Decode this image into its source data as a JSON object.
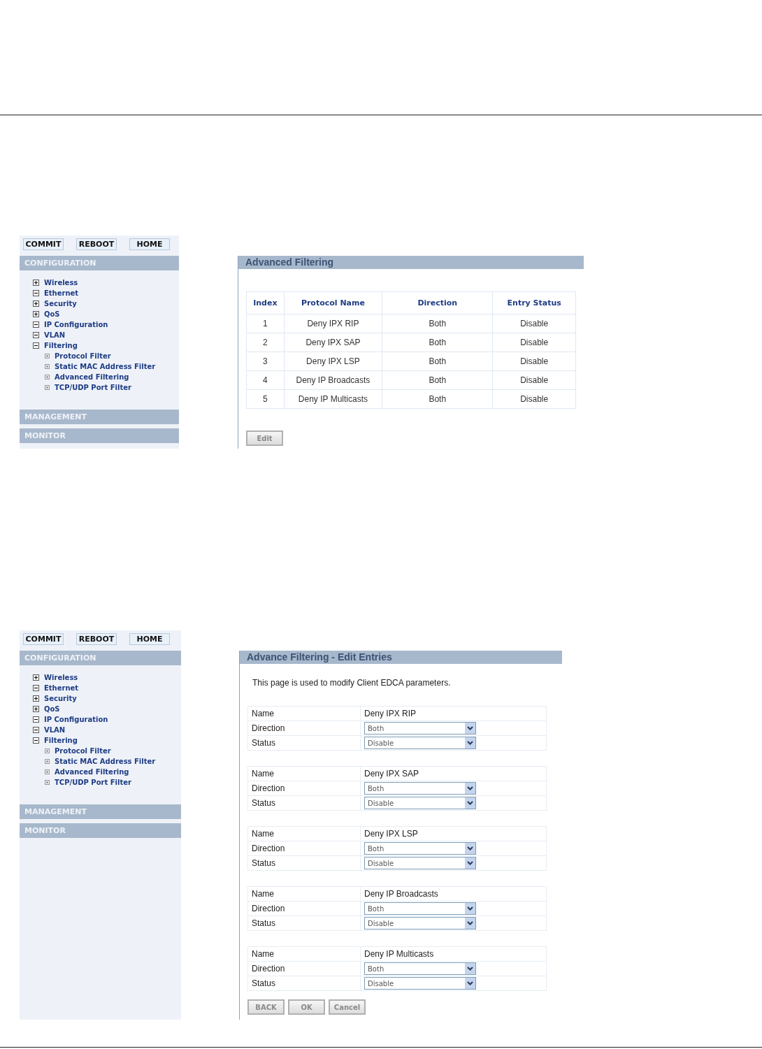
{
  "screens": [
    {
      "sidebar": {
        "buttons": [
          "COMMIT",
          "REBOOT",
          "HOME"
        ],
        "sections": [
          {
            "title": "CONFIGURATION",
            "items": [
              {
                "label": "Wireless",
                "expanded": false
              },
              {
                "label": "Ethernet",
                "expanded": true
              },
              {
                "label": "Security",
                "expanded": false
              },
              {
                "label": "QoS",
                "expanded": false
              },
              {
                "label": "IP Configuration",
                "expanded": true
              },
              {
                "label": "VLAN",
                "expanded": true
              },
              {
                "label": "Filtering",
                "expanded": true,
                "children": [
                  {
                    "label": "Protocol Filter"
                  },
                  {
                    "label": "Static MAC Address Filter"
                  },
                  {
                    "label": "Advanced Filtering"
                  },
                  {
                    "label": "TCP/UDP Port Filter"
                  }
                ]
              }
            ]
          },
          {
            "title": "MANAGEMENT"
          },
          {
            "title": "MONITOR"
          }
        ]
      },
      "panel": {
        "kind": "list",
        "title": "Advanced Filtering",
        "table": {
          "columns": [
            "Index",
            "Protocol Name",
            "Direction",
            "Entry Status"
          ],
          "rows": [
            [
              "1",
              "Deny IPX RIP",
              "Both",
              "Disable"
            ],
            [
              "2",
              "Deny IPX SAP",
              "Both",
              "Disable"
            ],
            [
              "3",
              "Deny IPX LSP",
              "Both",
              "Disable"
            ],
            [
              "4",
              "Deny IP Broadcasts",
              "Both",
              "Disable"
            ],
            [
              "5",
              "Deny IP Multicasts",
              "Both",
              "Disable"
            ]
          ]
        },
        "buttons": [
          "Edit"
        ]
      }
    },
    {
      "sidebar": {
        "buttons": [
          "COMMIT",
          "REBOOT",
          "HOME"
        ],
        "sections": [
          {
            "title": "CONFIGURATION",
            "items": [
              {
                "label": "Wireless",
                "expanded": false
              },
              {
                "label": "Ethernet",
                "expanded": true
              },
              {
                "label": "Security",
                "expanded": false
              },
              {
                "label": "QoS",
                "expanded": false
              },
              {
                "label": "IP Configuration",
                "expanded": true
              },
              {
                "label": "VLAN",
                "expanded": true
              },
              {
                "label": "Filtering",
                "expanded": true,
                "children": [
                  {
                    "label": "Protocol Filter"
                  },
                  {
                    "label": "Static MAC Address Filter"
                  },
                  {
                    "label": "Advanced Filtering"
                  },
                  {
                    "label": "TCP/UDP Port Filter"
                  }
                ]
              }
            ]
          },
          {
            "title": "MANAGEMENT"
          },
          {
            "title": "MONITOR"
          }
        ]
      },
      "panel": {
        "kind": "edit",
        "title": "Advance Filtering - Edit Entries",
        "description": "This page is used to modify Client EDCA parameters.",
        "entries": [
          {
            "name_label": "Name",
            "name": "Deny IPX RIP",
            "direction_label": "Direction",
            "direction": "Both",
            "status_label": "Status",
            "status": "Disable"
          },
          {
            "name_label": "Name",
            "name": "Deny IPX SAP",
            "direction_label": "Direction",
            "direction": "Both",
            "status_label": "Status",
            "status": "Disable"
          },
          {
            "name_label": "Name",
            "name": "Deny IPX LSP",
            "direction_label": "Direction",
            "direction": "Both",
            "status_label": "Status",
            "status": "Disable"
          },
          {
            "name_label": "Name",
            "name": "Deny IP Broadcasts",
            "direction_label": "Direction",
            "direction": "Both",
            "status_label": "Status",
            "status": "Disable"
          },
          {
            "name_label": "Name",
            "name": "Deny IP Multicasts",
            "direction_label": "Direction",
            "direction": "Both",
            "status_label": "Status",
            "status": "Disable"
          }
        ],
        "buttons": [
          "BACK",
          "OK",
          "Cancel"
        ]
      }
    }
  ]
}
